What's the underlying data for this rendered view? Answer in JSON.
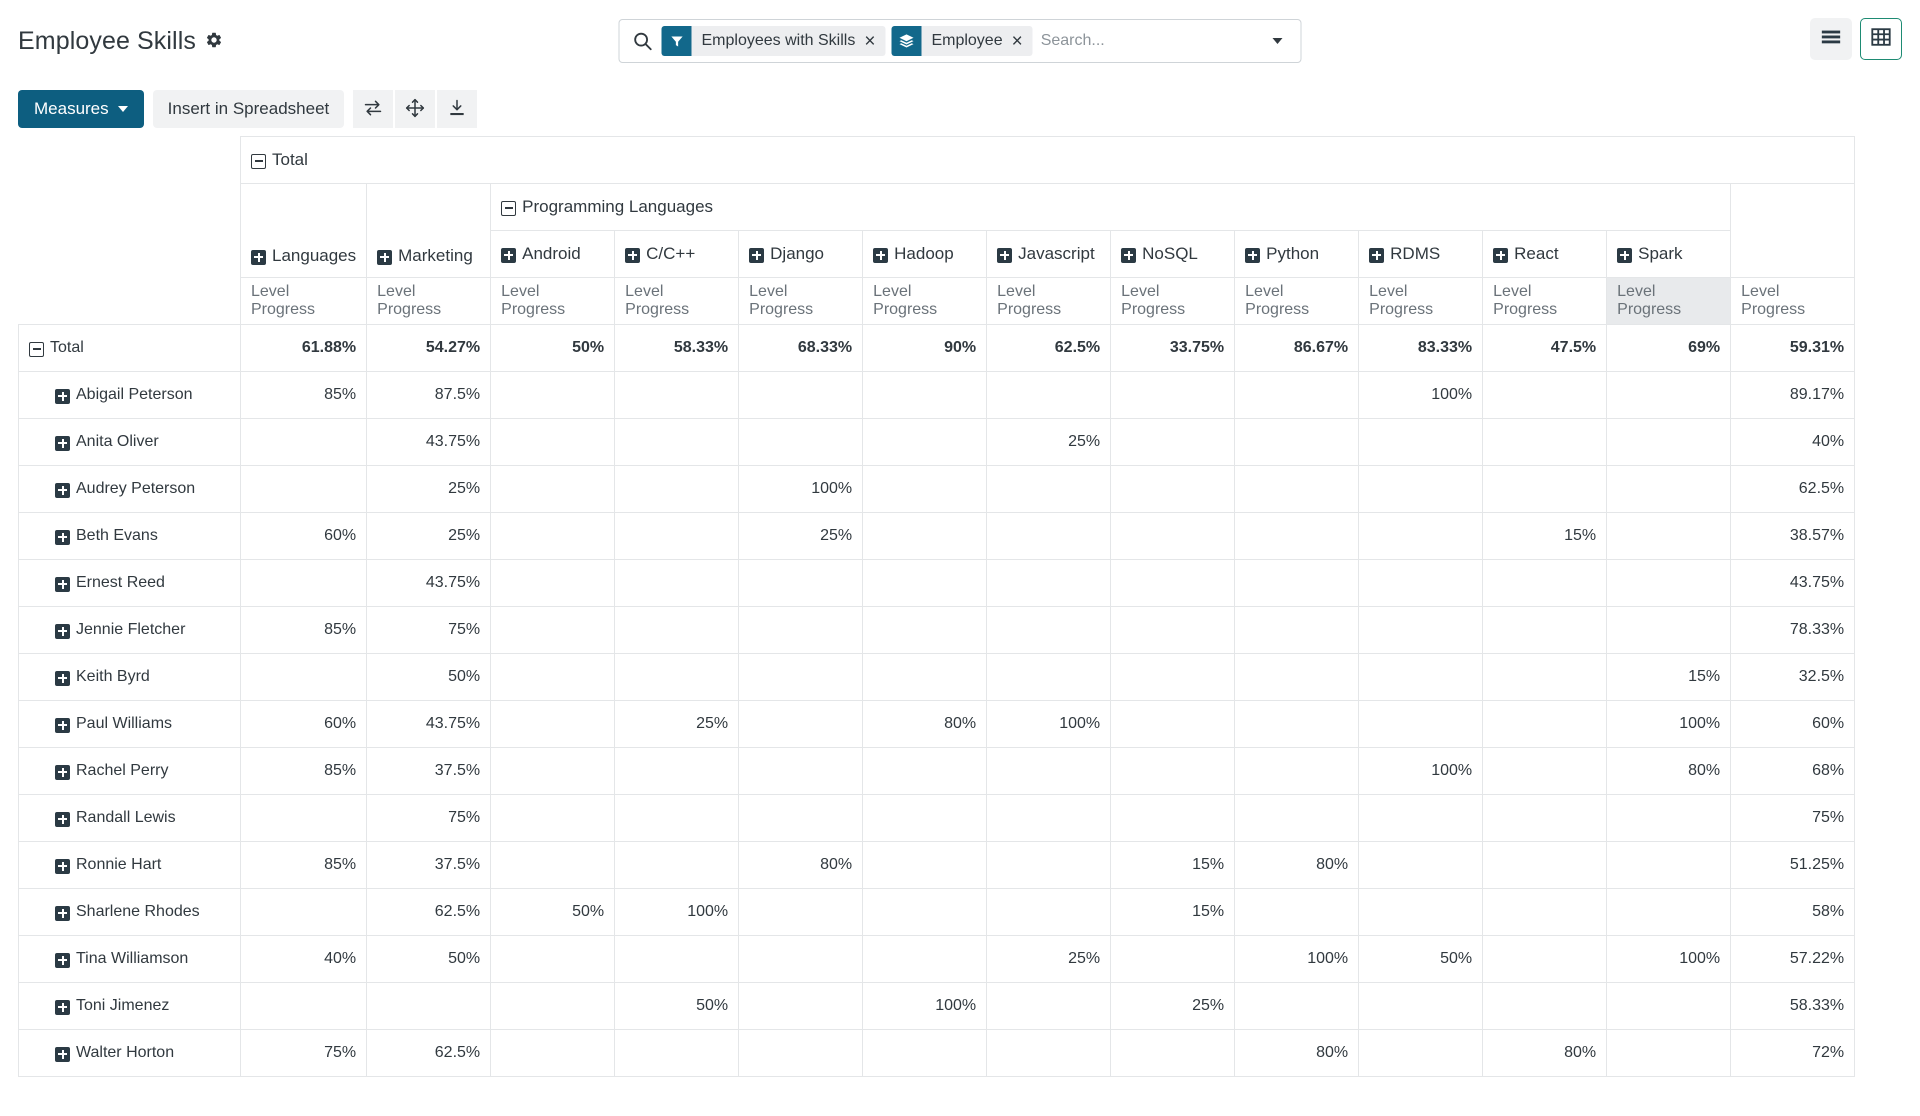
{
  "app": {
    "title": "Employee Skills",
    "settings_icon": "gear-icon"
  },
  "search": {
    "icon": "search-icon",
    "placeholder": "Search...",
    "value": "",
    "dropdown_icon": "chevron-down-icon",
    "facets": [
      {
        "icon": "filter-icon",
        "label": "Employees with Skills",
        "remove": "×"
      },
      {
        "icon": "layers-icon",
        "label": "Employee",
        "remove": "×"
      }
    ]
  },
  "view_switcher": {
    "buttons": [
      {
        "name": "list-view-button",
        "icon": "list-icon",
        "active": false
      },
      {
        "name": "pivot-view-button",
        "icon": "grid-icon",
        "active": true
      }
    ]
  },
  "toolbar": {
    "measures_label": "Measures",
    "measures_caret": "chevron-down-icon",
    "insert_spreadsheet_label": "Insert in Spreadsheet",
    "flip_axis_icon": "flip-axis-icon",
    "expand_all_icon": "expand-all-icon",
    "download_icon": "download-xlsx-icon"
  },
  "pivot": {
    "col_root_label": "Total",
    "col_root_expander": "minus",
    "group_label": "Programming Languages",
    "group_expander": "minus",
    "measure_label": "Level Progress",
    "hovered_measure_column_index": 11,
    "columns": [
      "Languages",
      "Marketing",
      "Android",
      "C/C++",
      "Django",
      "Hadoop",
      "Javascript",
      "NoSQL",
      "Python",
      "RDMS",
      "React",
      "Spark"
    ],
    "group_start_index": 2,
    "total_column_label": "",
    "rows": [
      {
        "label": "Total",
        "expander": "minus",
        "indent": false,
        "is_total": true,
        "values": [
          "61.88%",
          "54.27%",
          "50%",
          "58.33%",
          "68.33%",
          "90%",
          "62.5%",
          "33.75%",
          "86.67%",
          "83.33%",
          "47.5%",
          "69%"
        ],
        "total": "59.31%"
      },
      {
        "label": "Abigail Peterson",
        "expander": "plus",
        "indent": true,
        "is_total": false,
        "values": [
          "85%",
          "87.5%",
          "",
          "",
          "",
          "",
          "",
          "",
          "",
          "100%",
          "",
          ""
        ],
        "total": "89.17%"
      },
      {
        "label": "Anita Oliver",
        "expander": "plus",
        "indent": true,
        "is_total": false,
        "values": [
          "",
          "43.75%",
          "",
          "",
          "",
          "",
          "25%",
          "",
          "",
          "",
          "",
          ""
        ],
        "total": "40%"
      },
      {
        "label": "Audrey Peterson",
        "expander": "plus",
        "indent": true,
        "is_total": false,
        "values": [
          "",
          "25%",
          "",
          "",
          "100%",
          "",
          "",
          "",
          "",
          "",
          "",
          ""
        ],
        "total": "62.5%"
      },
      {
        "label": "Beth Evans",
        "expander": "plus",
        "indent": true,
        "is_total": false,
        "values": [
          "60%",
          "25%",
          "",
          "",
          "25%",
          "",
          "",
          "",
          "",
          "",
          "15%",
          ""
        ],
        "total": "38.57%"
      },
      {
        "label": "Ernest Reed",
        "expander": "plus",
        "indent": true,
        "is_total": false,
        "values": [
          "",
          "43.75%",
          "",
          "",
          "",
          "",
          "",
          "",
          "",
          "",
          "",
          ""
        ],
        "total": "43.75%"
      },
      {
        "label": "Jennie Fletcher",
        "expander": "plus",
        "indent": true,
        "is_total": false,
        "values": [
          "85%",
          "75%",
          "",
          "",
          "",
          "",
          "",
          "",
          "",
          "",
          "",
          ""
        ],
        "total": "78.33%"
      },
      {
        "label": "Keith Byrd",
        "expander": "plus",
        "indent": true,
        "is_total": false,
        "values": [
          "",
          "50%",
          "",
          "",
          "",
          "",
          "",
          "",
          "",
          "",
          "",
          "15%"
        ],
        "total": "32.5%"
      },
      {
        "label": "Paul Williams",
        "expander": "plus",
        "indent": true,
        "is_total": false,
        "values": [
          "60%",
          "43.75%",
          "",
          "25%",
          "",
          "80%",
          "100%",
          "",
          "",
          "",
          "",
          "100%"
        ],
        "total": "60%"
      },
      {
        "label": "Rachel Perry",
        "expander": "plus",
        "indent": true,
        "is_total": false,
        "values": [
          "85%",
          "37.5%",
          "",
          "",
          "",
          "",
          "",
          "",
          "",
          "100%",
          "",
          "80%"
        ],
        "total": "68%"
      },
      {
        "label": "Randall Lewis",
        "expander": "plus",
        "indent": true,
        "is_total": false,
        "values": [
          "",
          "75%",
          "",
          "",
          "",
          "",
          "",
          "",
          "",
          "",
          "",
          ""
        ],
        "total": "75%"
      },
      {
        "label": "Ronnie Hart",
        "expander": "plus",
        "indent": true,
        "is_total": false,
        "values": [
          "85%",
          "37.5%",
          "",
          "",
          "80%",
          "",
          "",
          "15%",
          "80%",
          "",
          "",
          ""
        ],
        "total": "51.25%"
      },
      {
        "label": "Sharlene Rhodes",
        "expander": "plus",
        "indent": true,
        "is_total": false,
        "values": [
          "",
          "62.5%",
          "50%",
          "100%",
          "",
          "",
          "",
          "15%",
          "",
          "",
          "",
          ""
        ],
        "total": "58%"
      },
      {
        "label": "Tina Williamson",
        "expander": "plus",
        "indent": true,
        "is_total": false,
        "values": [
          "40%",
          "50%",
          "",
          "",
          "",
          "",
          "25%",
          "",
          "100%",
          "50%",
          "",
          "100%"
        ],
        "total": "57.22%"
      },
      {
        "label": "Toni Jimenez",
        "expander": "plus",
        "indent": true,
        "is_total": false,
        "values": [
          "",
          "",
          "",
          "50%",
          "",
          "100%",
          "",
          "25%",
          "",
          "",
          "",
          ""
        ],
        "total": "58.33%"
      },
      {
        "label": "Walter Horton",
        "expander": "plus",
        "indent": true,
        "is_total": false,
        "values": [
          "75%",
          "62.5%",
          "",
          "",
          "",
          "",
          "",
          "",
          "80%",
          "",
          "80%",
          ""
        ],
        "total": "72%"
      }
    ]
  },
  "colors": {
    "primary": "#0d5e80",
    "accent_active_border": "#1e8b73",
    "facet_icon_bg": "#12688b",
    "text": "#31393f",
    "muted_text": "#6a7279",
    "grid_line": "#e4e6e8"
  }
}
